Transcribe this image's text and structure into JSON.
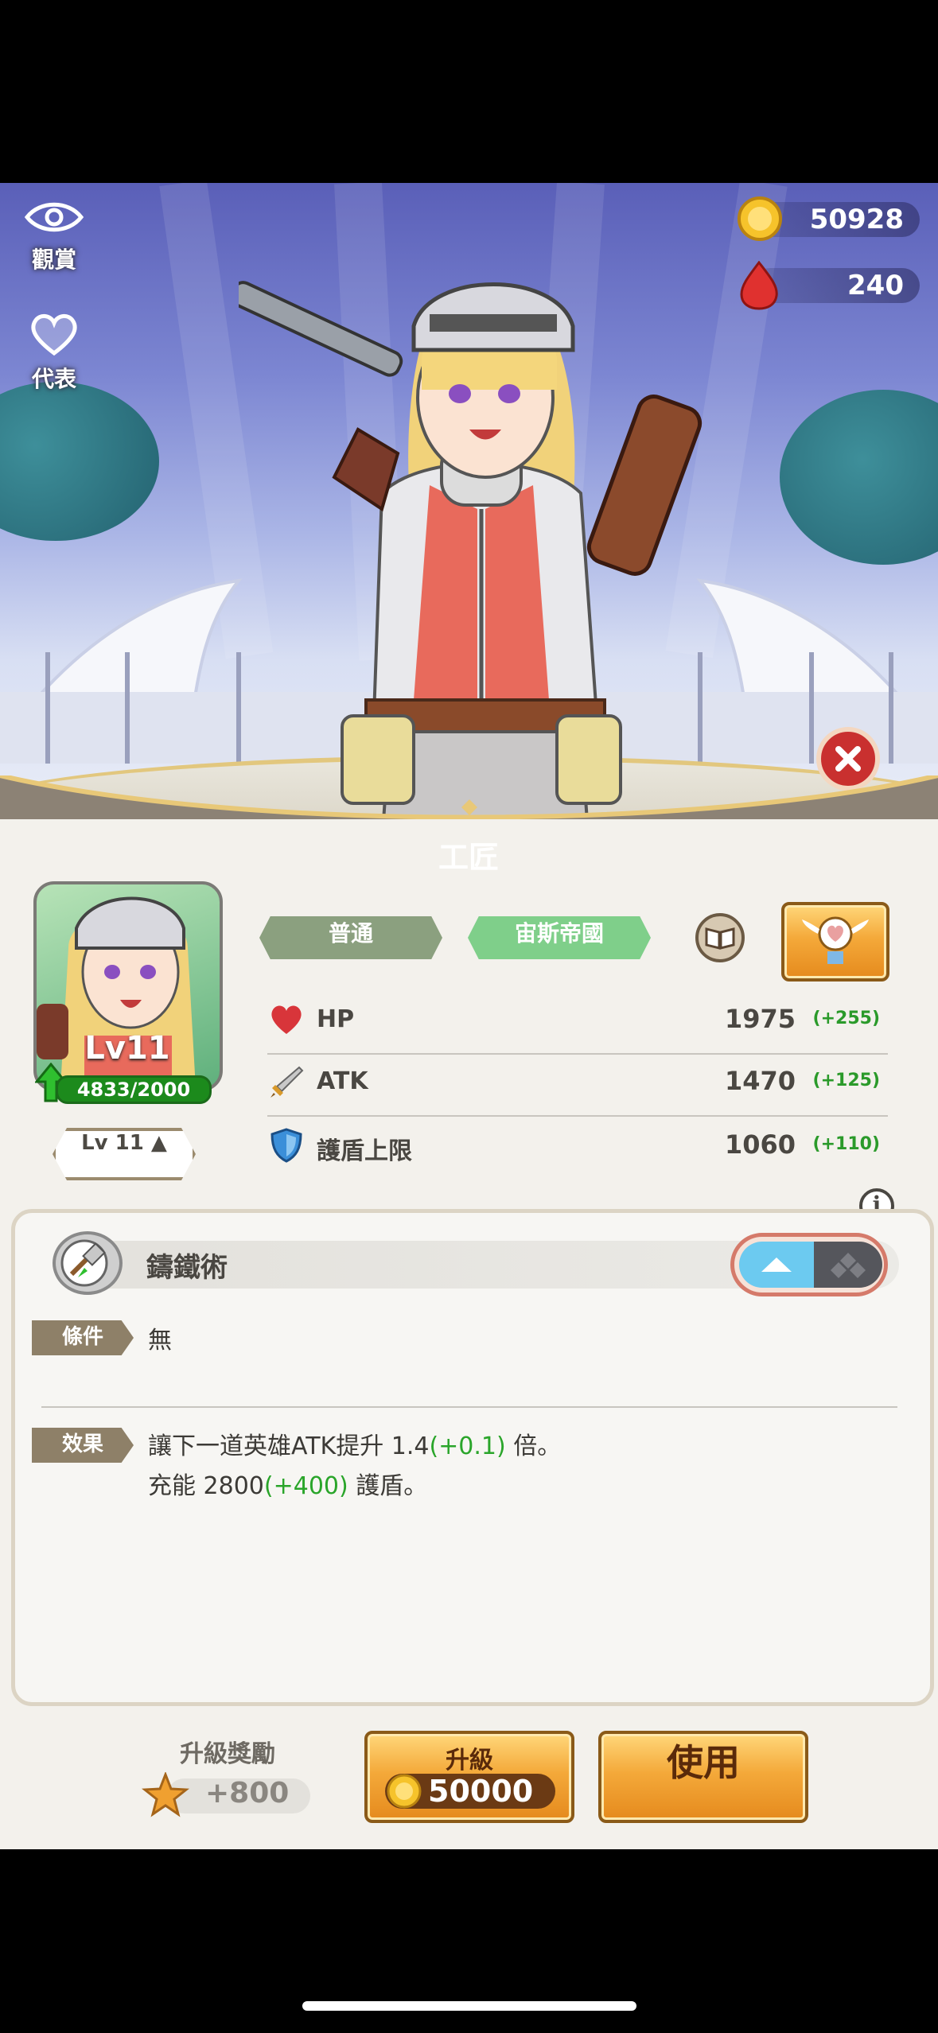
{
  "side": {
    "view_label": "觀賞",
    "rep_label": "代表"
  },
  "currency": {
    "gold": "50928",
    "gems": "240"
  },
  "hero": {
    "title": "工匠",
    "level_label": "Lv11",
    "exp": "4833/2000",
    "level_button": "Lv 11 ▲"
  },
  "tags": {
    "rarity": "普通",
    "faction": "宙斯帝國"
  },
  "stats": [
    {
      "name": "HP",
      "value": "1975",
      "bonus": "(+255)",
      "icon": "heart-icon"
    },
    {
      "name": "ATK",
      "value": "1470",
      "bonus": "(+125)",
      "icon": "sword-icon"
    },
    {
      "name": "護盾上限",
      "value": "1060",
      "bonus": "(+110)",
      "icon": "shield-icon"
    }
  ],
  "skill": {
    "name": "鑄鐵術",
    "condition_label": "條件",
    "condition_value": "無",
    "effect_label": "效果",
    "effect_line1_a": "讓下一道英雄ATK提升 1.4",
    "effect_line1_b": "(+0.1)",
    "effect_line1_c": " 倍。",
    "effect_line2_a": "充能 2800",
    "effect_line2_b": "(+400)",
    "effect_line2_c": " 護盾。"
  },
  "footer": {
    "reward_label": "升級獎勵",
    "reward_value": "+800",
    "upgrade_label": "升級",
    "upgrade_cost": "50000",
    "use_label": "使用"
  },
  "colors": {
    "accent_orange": "#f0a030",
    "tag_gray": "#8ba07f",
    "tag_green": "#7fcf8a",
    "bonus_green": "#2a9a2a"
  }
}
